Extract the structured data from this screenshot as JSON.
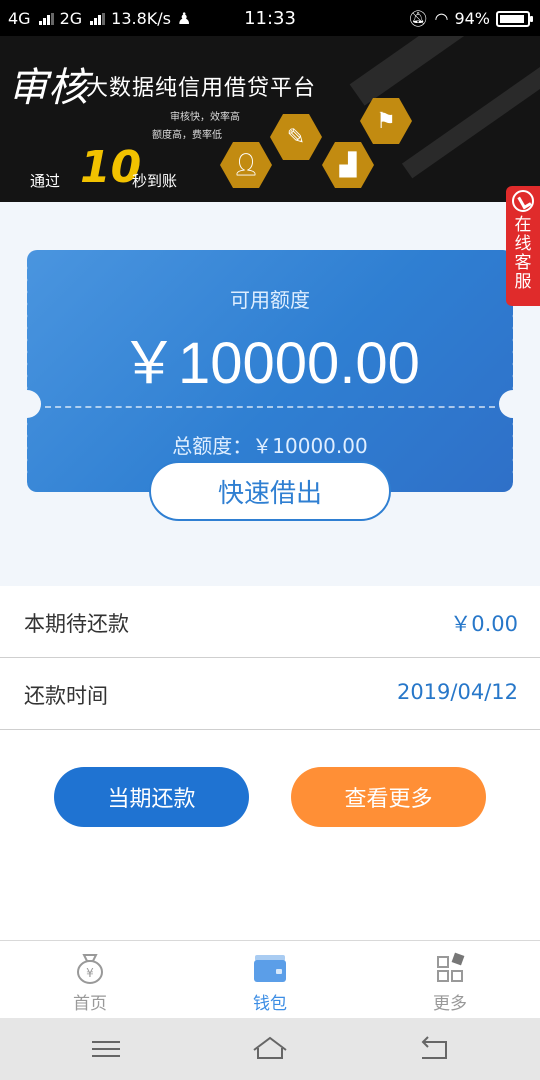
{
  "status_bar": {
    "network1": "4G",
    "network2": "2G",
    "speed": "13.8K/s",
    "time": "11:33",
    "battery": "94%",
    "battery_level": 0.94
  },
  "banner": {
    "callig1": "审核",
    "title": "大数据纯信用借贷平台",
    "feature1": "审核快，效率高",
    "feature2": "额度高，费率低",
    "slogan_prefix": "通过",
    "slogan_number": "10",
    "slogan_suffix": "秒到账"
  },
  "card": {
    "label": "可用额度",
    "amount": "￥10000.00",
    "total": "总额度：￥10000.00"
  },
  "borrow_button": "快速借出",
  "service_button": [
    "在",
    "线",
    "客",
    "服"
  ],
  "info": {
    "current_due_label": "本期待还款",
    "current_due_value": "￥0.00",
    "due_date_label": "还款时间",
    "due_date_value": "2019/04/12"
  },
  "actions": {
    "repay": "当期还款",
    "more": "查看更多"
  },
  "tabs": [
    {
      "label": "首页",
      "icon": "money-bag-icon",
      "active": false
    },
    {
      "label": "钱包",
      "icon": "wallet-icon",
      "active": true
    },
    {
      "label": "更多",
      "icon": "grid-icon",
      "active": false
    }
  ],
  "colors": {
    "primary": "#1f73d2",
    "accent": "#ff8f36",
    "service": "#e02b2b",
    "value_text": "#2777c9"
  }
}
